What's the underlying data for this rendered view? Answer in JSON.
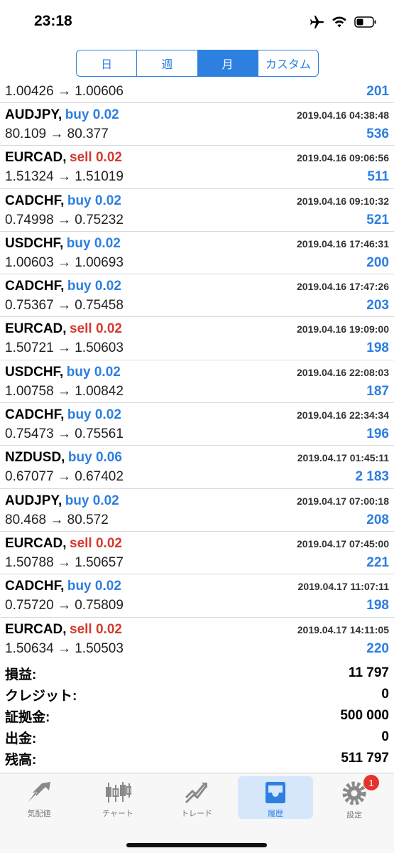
{
  "status": {
    "time": "23:18"
  },
  "segments": [
    {
      "label": "日"
    },
    {
      "label": "週"
    },
    {
      "label": "月",
      "active": true
    },
    {
      "label": "カスタム"
    }
  ],
  "partial_row": {
    "prices": "1.00426 → 1.00606",
    "profit": "201"
  },
  "trades": [
    {
      "symbol": "AUDJPY,",
      "side": "buy 0.02",
      "type": "buy",
      "time": "2019.04.16 04:38:48",
      "prices": "80.109 → 80.377",
      "profit": "536"
    },
    {
      "symbol": "EURCAD,",
      "side": "sell 0.02",
      "type": "sell",
      "time": "2019.04.16 09:06:56",
      "prices": "1.51324 → 1.51019",
      "profit": "511"
    },
    {
      "symbol": "CADCHF,",
      "side": "buy 0.02",
      "type": "buy",
      "time": "2019.04.16 09:10:32",
      "prices": "0.74998 → 0.75232",
      "profit": "521"
    },
    {
      "symbol": "USDCHF,",
      "side": "buy 0.02",
      "type": "buy",
      "time": "2019.04.16 17:46:31",
      "prices": "1.00603 → 1.00693",
      "profit": "200"
    },
    {
      "symbol": "CADCHF,",
      "side": "buy 0.02",
      "type": "buy",
      "time": "2019.04.16 17:47:26",
      "prices": "0.75367 → 0.75458",
      "profit": "203"
    },
    {
      "symbol": "EURCAD,",
      "side": "sell 0.02",
      "type": "sell",
      "time": "2019.04.16 19:09:00",
      "prices": "1.50721 → 1.50603",
      "profit": "198"
    },
    {
      "symbol": "USDCHF,",
      "side": "buy 0.02",
      "type": "buy",
      "time": "2019.04.16 22:08:03",
      "prices": "1.00758 → 1.00842",
      "profit": "187"
    },
    {
      "symbol": "CADCHF,",
      "side": "buy 0.02",
      "type": "buy",
      "time": "2019.04.16 22:34:34",
      "prices": "0.75473 → 0.75561",
      "profit": "196"
    },
    {
      "symbol": "NZDUSD,",
      "side": "buy 0.06",
      "type": "buy",
      "time": "2019.04.17 01:45:11",
      "prices": "0.67077 → 0.67402",
      "profit": "2 183"
    },
    {
      "symbol": "AUDJPY,",
      "side": "buy 0.02",
      "type": "buy",
      "time": "2019.04.17 07:00:18",
      "prices": "80.468 → 80.572",
      "profit": "208"
    },
    {
      "symbol": "EURCAD,",
      "side": "sell 0.02",
      "type": "sell",
      "time": "2019.04.17 07:45:00",
      "prices": "1.50788 → 1.50657",
      "profit": "221"
    },
    {
      "symbol": "CADCHF,",
      "side": "buy 0.02",
      "type": "buy",
      "time": "2019.04.17 11:07:11",
      "prices": "0.75720 → 0.75809",
      "profit": "198"
    },
    {
      "symbol": "EURCAD,",
      "side": "sell 0.02",
      "type": "sell",
      "time": "2019.04.17 14:11:05",
      "prices": "1.50634 → 1.50503",
      "profit": "220"
    }
  ],
  "summary": [
    {
      "label": "損益:",
      "value": "11 797"
    },
    {
      "label": "クレジット:",
      "value": "0"
    },
    {
      "label": "証拠金:",
      "value": "500 000"
    },
    {
      "label": "出金:",
      "value": "0"
    },
    {
      "label": "残高:",
      "value": "511 797"
    }
  ],
  "tabs": [
    {
      "label": "気配値",
      "icon": "quotes-icon"
    },
    {
      "label": "チャート",
      "icon": "chart-icon"
    },
    {
      "label": "トレード",
      "icon": "trade-icon"
    },
    {
      "label": "履歴",
      "icon": "history-icon",
      "active": true
    },
    {
      "label": "設定",
      "icon": "settings-icon",
      "badge": "1"
    }
  ],
  "colors": {
    "accent": "#2d7fe0",
    "sell": "#d43b2f",
    "badge": "#e5322d"
  }
}
